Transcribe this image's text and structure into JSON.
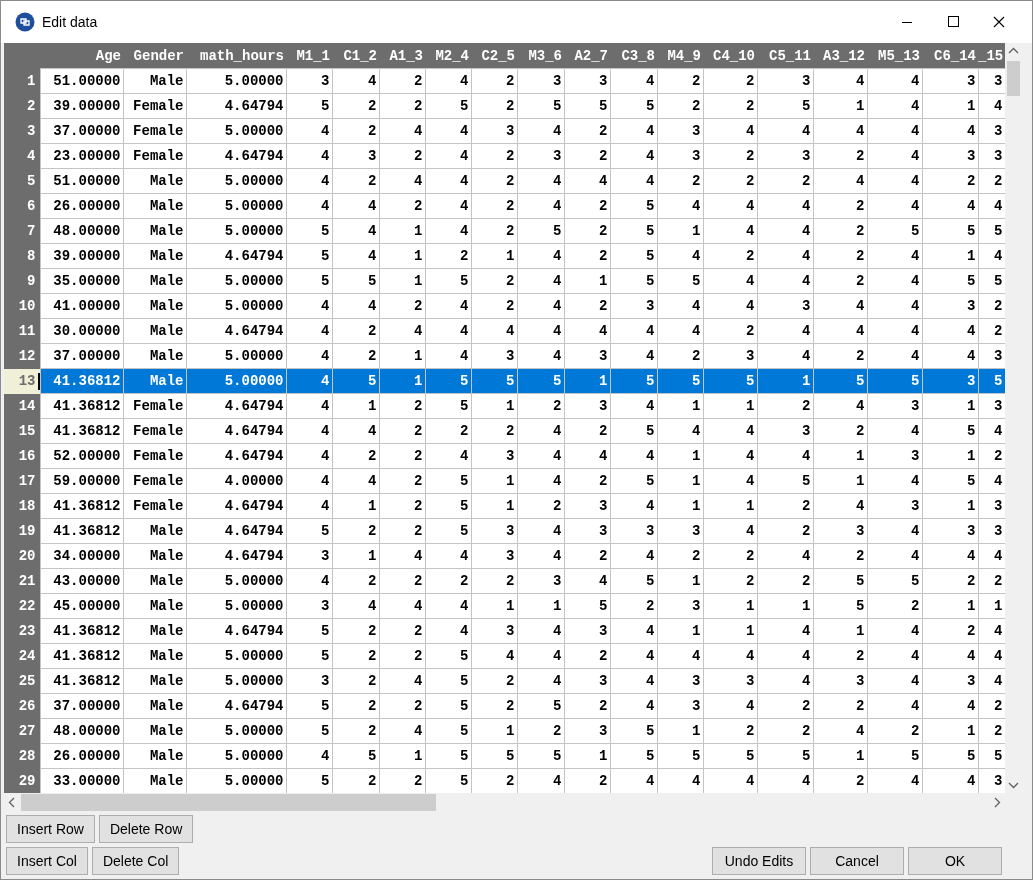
{
  "window": {
    "title": "Edit data"
  },
  "table": {
    "columns": [
      "Age",
      "Gender",
      "math_hours",
      "M1_1",
      "C1_2",
      "A1_3",
      "M2_4",
      "C2_5",
      "M3_6",
      "A2_7",
      "C3_8",
      "M4_9",
      "C4_10",
      "C5_11",
      "A3_12",
      "M5_13",
      "C6_14",
      "_15"
    ],
    "rows": [
      {
        "number": "1",
        "selected": false,
        "cells": [
          "51.00000",
          "Male",
          "5.00000",
          "3",
          "4",
          "2",
          "4",
          "2",
          "3",
          "3",
          "4",
          "2",
          "2",
          "3",
          "4",
          "4",
          "3",
          "3"
        ]
      },
      {
        "number": "2",
        "selected": false,
        "cells": [
          "39.00000",
          "Female",
          "4.64794",
          "5",
          "2",
          "2",
          "5",
          "2",
          "5",
          "5",
          "5",
          "2",
          "2",
          "5",
          "1",
          "4",
          "1",
          "4"
        ]
      },
      {
        "number": "3",
        "selected": false,
        "cells": [
          "37.00000",
          "Female",
          "5.00000",
          "4",
          "2",
          "4",
          "4",
          "3",
          "4",
          "2",
          "4",
          "3",
          "4",
          "4",
          "4",
          "4",
          "4",
          "3"
        ]
      },
      {
        "number": "4",
        "selected": false,
        "cells": [
          "23.00000",
          "Female",
          "4.64794",
          "4",
          "3",
          "2",
          "4",
          "2",
          "3",
          "2",
          "4",
          "3",
          "2",
          "3",
          "2",
          "4",
          "3",
          "3"
        ]
      },
      {
        "number": "5",
        "selected": false,
        "cells": [
          "51.00000",
          "Male",
          "5.00000",
          "4",
          "2",
          "4",
          "4",
          "2",
          "4",
          "4",
          "4",
          "2",
          "2",
          "2",
          "4",
          "4",
          "2",
          "2"
        ]
      },
      {
        "number": "6",
        "selected": false,
        "cells": [
          "26.00000",
          "Male",
          "5.00000",
          "4",
          "4",
          "2",
          "4",
          "2",
          "4",
          "2",
          "5",
          "4",
          "4",
          "4",
          "2",
          "4",
          "4",
          "4"
        ]
      },
      {
        "number": "7",
        "selected": false,
        "cells": [
          "48.00000",
          "Male",
          "5.00000",
          "5",
          "4",
          "1",
          "4",
          "2",
          "5",
          "2",
          "5",
          "1",
          "4",
          "4",
          "2",
          "5",
          "5",
          "5"
        ]
      },
      {
        "number": "8",
        "selected": false,
        "cells": [
          "39.00000",
          "Male",
          "4.64794",
          "5",
          "4",
          "1",
          "2",
          "1",
          "4",
          "2",
          "5",
          "4",
          "2",
          "4",
          "2",
          "4",
          "1",
          "4"
        ]
      },
      {
        "number": "9",
        "selected": false,
        "cells": [
          "35.00000",
          "Male",
          "5.00000",
          "5",
          "5",
          "1",
          "5",
          "2",
          "4",
          "1",
          "5",
          "5",
          "4",
          "4",
          "2",
          "4",
          "5",
          "5"
        ]
      },
      {
        "number": "10",
        "selected": false,
        "cells": [
          "41.00000",
          "Male",
          "5.00000",
          "4",
          "4",
          "2",
          "4",
          "2",
          "4",
          "2",
          "3",
          "4",
          "4",
          "3",
          "4",
          "4",
          "3",
          "2"
        ]
      },
      {
        "number": "11",
        "selected": false,
        "cells": [
          "30.00000",
          "Male",
          "4.64794",
          "4",
          "2",
          "4",
          "4",
          "4",
          "4",
          "4",
          "4",
          "4",
          "2",
          "4",
          "4",
          "4",
          "4",
          "2"
        ]
      },
      {
        "number": "12",
        "selected": false,
        "cells": [
          "37.00000",
          "Male",
          "5.00000",
          "4",
          "2",
          "1",
          "4",
          "3",
          "4",
          "3",
          "4",
          "2",
          "3",
          "4",
          "2",
          "4",
          "4",
          "3"
        ]
      },
      {
        "number": "13",
        "selected": true,
        "cells": [
          "41.36812",
          "Male",
          "5.00000",
          "4",
          "5",
          "1",
          "5",
          "5",
          "5",
          "1",
          "5",
          "5",
          "5",
          "1",
          "5",
          "5",
          "3",
          "5"
        ]
      },
      {
        "number": "14",
        "selected": false,
        "cells": [
          "41.36812",
          "Female",
          "4.64794",
          "4",
          "1",
          "2",
          "5",
          "1",
          "2",
          "3",
          "4",
          "1",
          "1",
          "2",
          "4",
          "3",
          "1",
          "3"
        ]
      },
      {
        "number": "15",
        "selected": false,
        "cells": [
          "41.36812",
          "Female",
          "4.64794",
          "4",
          "4",
          "2",
          "2",
          "2",
          "4",
          "2",
          "5",
          "4",
          "4",
          "3",
          "2",
          "4",
          "5",
          "4"
        ]
      },
      {
        "number": "16",
        "selected": false,
        "cells": [
          "52.00000",
          "Female",
          "4.64794",
          "4",
          "2",
          "2",
          "4",
          "3",
          "4",
          "4",
          "4",
          "1",
          "4",
          "4",
          "1",
          "3",
          "1",
          "2"
        ]
      },
      {
        "number": "17",
        "selected": false,
        "cells": [
          "59.00000",
          "Female",
          "4.00000",
          "4",
          "4",
          "2",
          "5",
          "1",
          "4",
          "2",
          "5",
          "1",
          "4",
          "5",
          "1",
          "4",
          "5",
          "4"
        ]
      },
      {
        "number": "18",
        "selected": false,
        "cells": [
          "41.36812",
          "Female",
          "4.64794",
          "4",
          "1",
          "2",
          "5",
          "1",
          "2",
          "3",
          "4",
          "1",
          "1",
          "2",
          "4",
          "3",
          "1",
          "3"
        ]
      },
      {
        "number": "19",
        "selected": false,
        "cells": [
          "41.36812",
          "Male",
          "4.64794",
          "5",
          "2",
          "2",
          "5",
          "3",
          "4",
          "3",
          "3",
          "3",
          "4",
          "2",
          "3",
          "4",
          "3",
          "3"
        ]
      },
      {
        "number": "20",
        "selected": false,
        "cells": [
          "34.00000",
          "Male",
          "4.64794",
          "3",
          "1",
          "4",
          "4",
          "3",
          "4",
          "2",
          "4",
          "2",
          "2",
          "4",
          "2",
          "4",
          "4",
          "4"
        ]
      },
      {
        "number": "21",
        "selected": false,
        "cells": [
          "43.00000",
          "Male",
          "5.00000",
          "4",
          "2",
          "2",
          "2",
          "2",
          "3",
          "4",
          "5",
          "1",
          "2",
          "2",
          "5",
          "5",
          "2",
          "2"
        ]
      },
      {
        "number": "22",
        "selected": false,
        "cells": [
          "45.00000",
          "Male",
          "5.00000",
          "3",
          "4",
          "4",
          "4",
          "1",
          "1",
          "5",
          "2",
          "3",
          "1",
          "1",
          "5",
          "2",
          "1",
          "1"
        ]
      },
      {
        "number": "23",
        "selected": false,
        "cells": [
          "41.36812",
          "Male",
          "4.64794",
          "5",
          "2",
          "2",
          "4",
          "3",
          "4",
          "3",
          "4",
          "1",
          "1",
          "4",
          "1",
          "4",
          "2",
          "4"
        ]
      },
      {
        "number": "24",
        "selected": false,
        "cells": [
          "41.36812",
          "Male",
          "5.00000",
          "5",
          "2",
          "2",
          "5",
          "4",
          "4",
          "2",
          "4",
          "4",
          "4",
          "4",
          "2",
          "4",
          "4",
          "4"
        ]
      },
      {
        "number": "25",
        "selected": false,
        "cells": [
          "41.36812",
          "Male",
          "5.00000",
          "3",
          "2",
          "4",
          "5",
          "2",
          "4",
          "3",
          "4",
          "3",
          "3",
          "4",
          "3",
          "4",
          "3",
          "4"
        ]
      },
      {
        "number": "26",
        "selected": false,
        "cells": [
          "37.00000",
          "Male",
          "4.64794",
          "5",
          "2",
          "2",
          "5",
          "2",
          "5",
          "2",
          "4",
          "3",
          "4",
          "2",
          "2",
          "4",
          "4",
          "2"
        ]
      },
      {
        "number": "27",
        "selected": false,
        "cells": [
          "48.00000",
          "Male",
          "5.00000",
          "5",
          "2",
          "4",
          "5",
          "1",
          "2",
          "3",
          "5",
          "1",
          "2",
          "2",
          "4",
          "2",
          "1",
          "2"
        ]
      },
      {
        "number": "28",
        "selected": false,
        "cells": [
          "26.00000",
          "Male",
          "5.00000",
          "4",
          "5",
          "1",
          "5",
          "5",
          "5",
          "1",
          "5",
          "5",
          "5",
          "5",
          "1",
          "5",
          "5",
          "5"
        ]
      },
      {
        "number": "29",
        "selected": false,
        "cells": [
          "33.00000",
          "Male",
          "5.00000",
          "5",
          "2",
          "2",
          "5",
          "2",
          "4",
          "2",
          "4",
          "4",
          "4",
          "4",
          "2",
          "4",
          "4",
          "3"
        ]
      }
    ]
  },
  "row_buttons": [
    "Insert Row",
    "Delete Row"
  ],
  "col_buttons": [
    "Insert Col",
    "Delete Col"
  ],
  "dialog_buttons": [
    "Undo Edits",
    "Cancel",
    "OK"
  ]
}
